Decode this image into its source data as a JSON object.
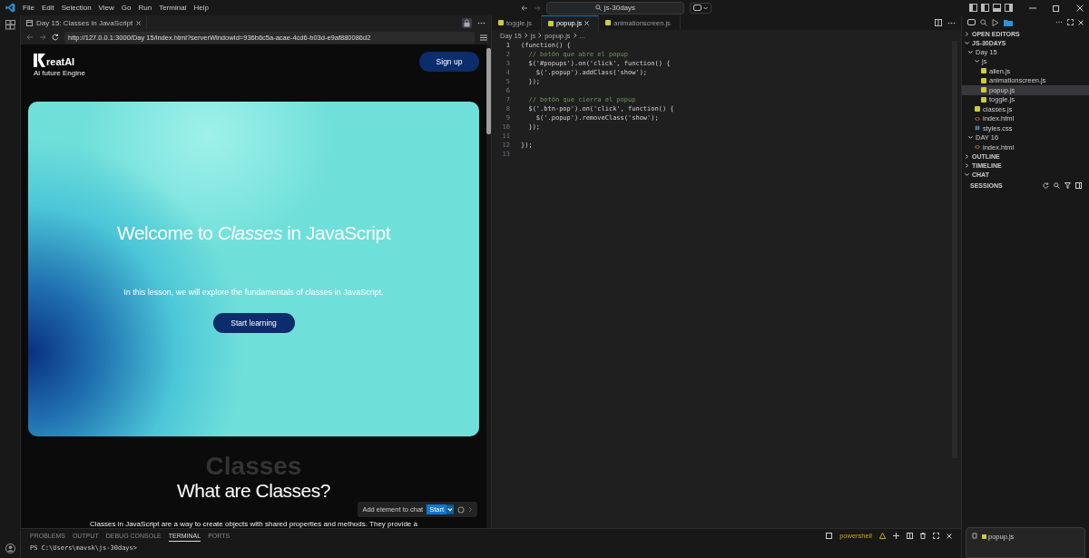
{
  "menu": [
    "File",
    "Edit",
    "Selection",
    "View",
    "Go",
    "Run",
    "Terminal",
    "Help"
  ],
  "search": {
    "value": "js-30days"
  },
  "browser": {
    "tab": "Day 15: Classes in JavaScript",
    "url": "http://127.0.0.1:3000/Day 15/index.html?serverWindowId=936b6c5a-acae-4cd6-b03d-e9af880086d2",
    "page": {
      "logo": "reatAI",
      "tagline": "Ai future Engine",
      "signup": "Sign up",
      "hero": {
        "title": "Welcome to *Classes* in JavaScript",
        "text": "In this lesson, we will explore the fundamentals of classes in JavaScript.",
        "button": "Start learning"
      },
      "section": {
        "title": "What are Classes?",
        "backdrop": "Classes",
        "text": "Classes in JavaScript are a way to create objects with shared properties and methods. They provide a"
      }
    },
    "chat_toolbar": {
      "label": "Add element to chat",
      "button": "Start"
    }
  },
  "editor": {
    "tabs": [
      {
        "label": "toggle.js",
        "selected": false
      },
      {
        "label": "popup.js",
        "selected": true
      },
      {
        "label": "animationscreen.js",
        "selected": false
      }
    ],
    "breadcrumb": [
      "Day 15",
      "js",
      "popup.js",
      "..."
    ],
    "lines": [
      {
        "num": "1",
        "active": true,
        "kind": "code",
        "text": "(function() {"
      },
      {
        "num": "2",
        "active": false,
        "kind": "comment",
        "text": "  // botón que abre el popup"
      },
      {
        "num": "3",
        "active": false,
        "kind": "code",
        "text": "  $('#popups').on('click', function() {"
      },
      {
        "num": "4",
        "active": false,
        "kind": "code",
        "text": "    $('.popup').addClass('show');"
      },
      {
        "num": "5",
        "active": false,
        "kind": "code",
        "text": "  });"
      },
      {
        "num": "6",
        "active": false,
        "kind": "blank"
      },
      {
        "num": "7",
        "active": false,
        "kind": "comment",
        "text": "  // botón que cierra el popup"
      },
      {
        "num": "8",
        "active": false,
        "kind": "code",
        "text": "  $('.btn-pop').on('click', function() {"
      },
      {
        "num": "9",
        "active": false,
        "kind": "code",
        "text": "    $('.popup').removeClass('show');"
      },
      {
        "num": "10",
        "active": false,
        "kind": "code",
        "text": "  });"
      },
      {
        "num": "11",
        "active": false,
        "kind": "blank"
      },
      {
        "num": "12",
        "active": false,
        "kind": "code",
        "text": "});"
      },
      {
        "num": "13",
        "active": false,
        "kind": "blank"
      }
    ]
  },
  "panel": {
    "tabs": [
      {
        "label": "PROBLEMS",
        "selected": false
      },
      {
        "label": "OUTPUT",
        "selected": false
      },
      {
        "label": "DEBUG CONSOLE",
        "selected": false
      },
      {
        "label": "TERMINAL",
        "selected": true
      },
      {
        "label": "PORTS",
        "selected": false
      }
    ],
    "prompt": "PS C:\\Users\\mavsk\\js-30days>",
    "shell": "powershell"
  },
  "sidebar": {
    "sections": [
      {
        "label": "OPEN EDITORS",
        "expanded": false
      },
      {
        "label": "JS-30DAYS",
        "expanded": true,
        "children": [
          {
            "label": "Day 15",
            "kind": "folder",
            "expanded": true,
            "selected": false,
            "children": [
              {
                "label": "js",
                "kind": "folder",
                "expanded": true,
                "selected": false,
                "children": [
                  {
                    "label": "alien.js",
                    "kind": "js",
                    "selected": false
                  },
                  {
                    "label": "animationscreen.js",
                    "kind": "js",
                    "selected": false
                  },
                  {
                    "label": "popup.js",
                    "kind": "js",
                    "selected": true
                  },
                  {
                    "label": "toggle.js",
                    "kind": "js",
                    "selected": false
                  }
                ]
              },
              {
                "label": "classes.js",
                "kind": "js",
                "selected": false
              },
              {
                "label": "index.html",
                "kind": "html",
                "selected": false
              },
              {
                "label": "styles.css",
                "kind": "css",
                "selected": false
              }
            ]
          },
          {
            "label": "DAY 16",
            "kind": "folder",
            "expanded": true,
            "selected": false,
            "children": [
              {
                "label": "index.html",
                "kind": "html",
                "selected": false
              }
            ]
          }
        ]
      },
      {
        "label": "OUTLINE",
        "expanded": false
      },
      {
        "label": "TIMELINE",
        "expanded": false
      },
      {
        "label": "CHAT",
        "expanded": true
      }
    ],
    "sessions": "SESSIONS",
    "chat_attachment": "popup.js"
  }
}
